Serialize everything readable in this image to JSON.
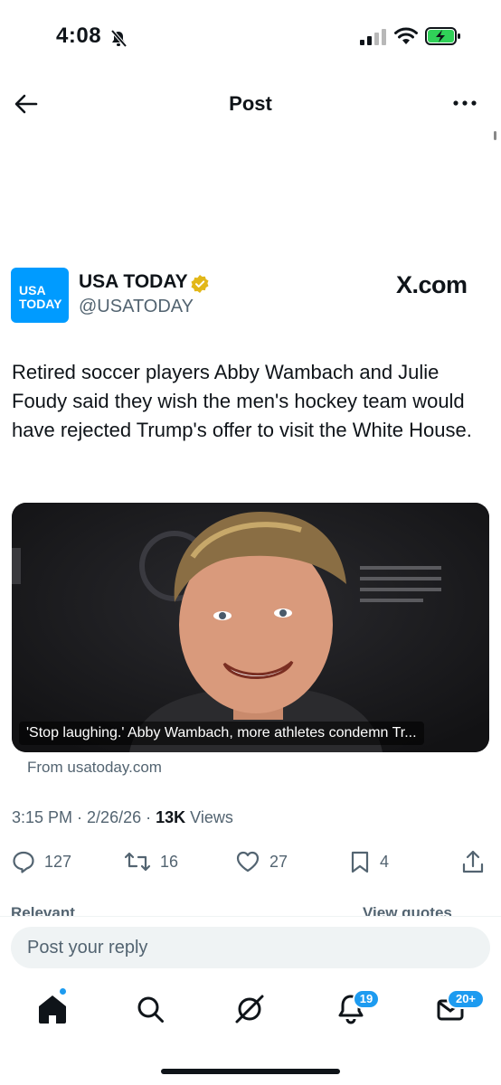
{
  "status_bar": {
    "time": "4:08"
  },
  "nav": {
    "title": "Post"
  },
  "account": {
    "avatar_text": "USA TODAY",
    "name": "USA TODAY",
    "handle": "@USATODAY",
    "site": "X.com"
  },
  "post": {
    "text": "Retired soccer players Abby Wambach and Julie Foudy said they wish the men's hockey team would have rejected Trump's offer to visit the White House.",
    "card_caption": "'Stop laughing.' Abby Wambach, more athletes condemn Tr...",
    "card_source": "From usatoday.com",
    "time": "3:15 PM",
    "date": "2/26/26",
    "views_count": "13K",
    "views_label": "Views"
  },
  "actions": {
    "replies": "127",
    "reposts": "16",
    "likes": "27",
    "bookmarks": "4"
  },
  "tabs": {
    "relevant": "Relevant",
    "view_quotes": "View quotes"
  },
  "reply": {
    "placeholder": "Post your reply"
  },
  "bottom_nav": {
    "notifications_badge": "19",
    "messages_badge": "20+"
  },
  "colors": {
    "accent": "#1d9bf0",
    "avatar_bg": "#009bff",
    "muted": "#536471",
    "battery": "#30d158"
  }
}
